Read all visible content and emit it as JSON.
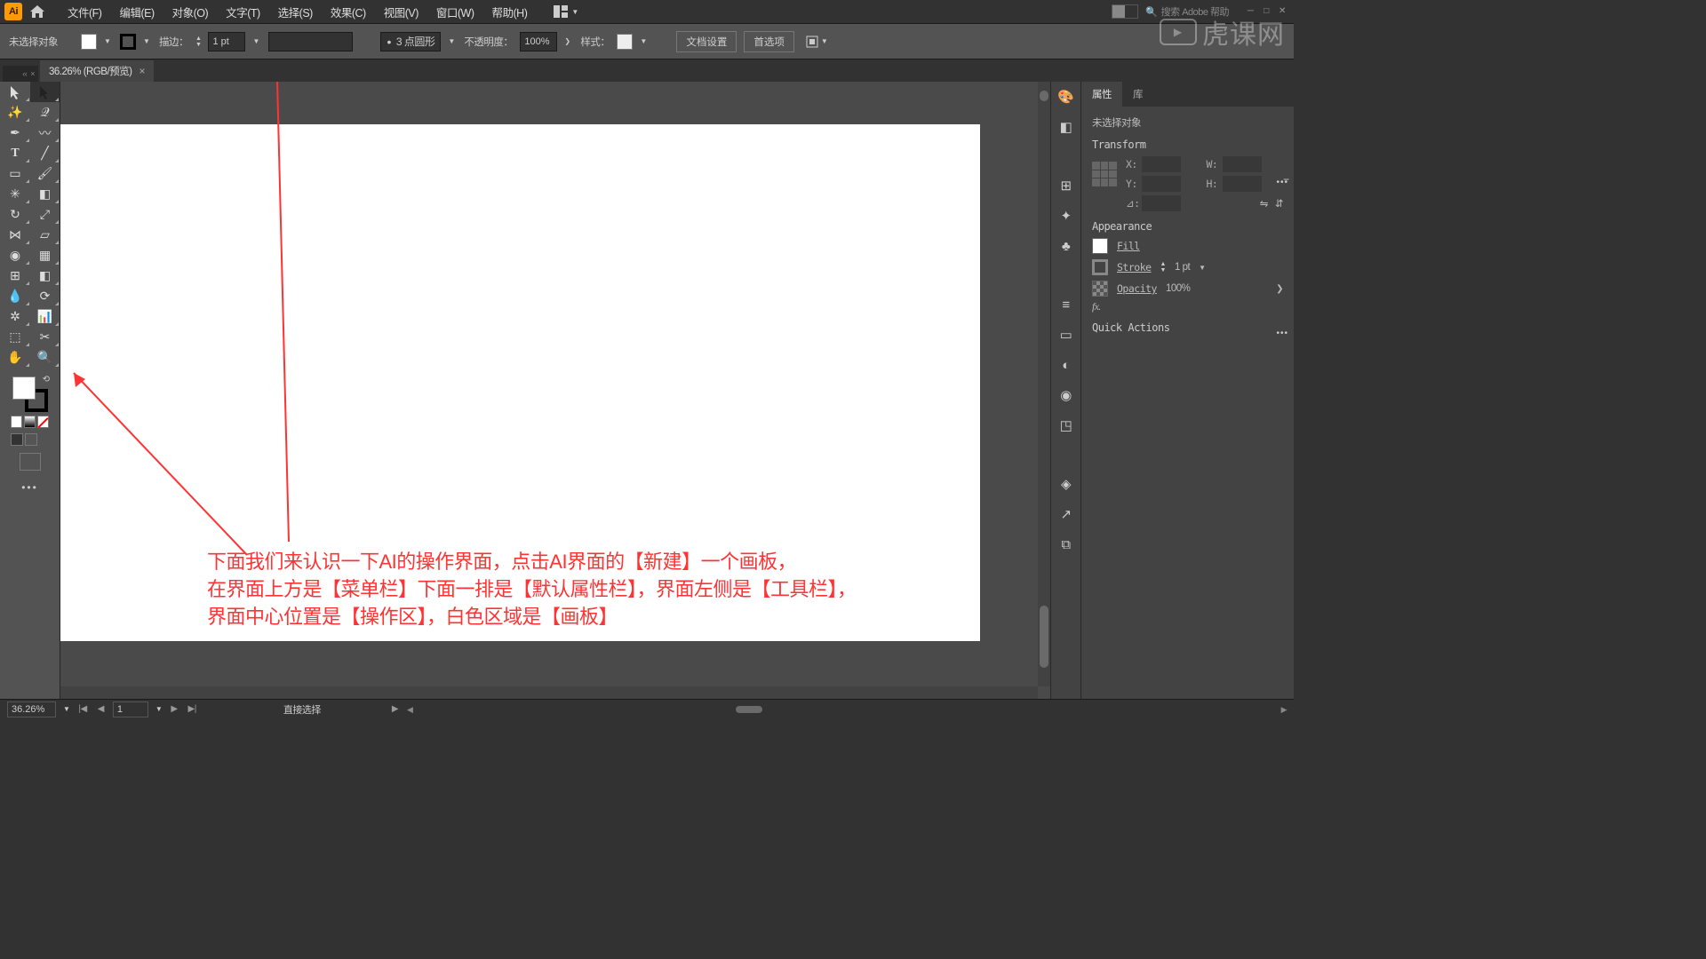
{
  "menubar": {
    "items": [
      "文件(F)",
      "编辑(E)",
      "对象(O)",
      "文字(T)",
      "选择(S)",
      "效果(C)",
      "视图(V)",
      "窗口(W)",
      "帮助(H)"
    ],
    "search_placeholder": "搜索 Adobe 帮助"
  },
  "controlbar": {
    "selection_label": "未选择对象",
    "stroke_label": "描边：",
    "stroke_value": "1 pt",
    "brush_label": "3 点圆形",
    "opacity_label": "不透明度：",
    "opacity_value": "100%",
    "style_label": "样式：",
    "doc_setup": "文档设置",
    "prefs": "首选项"
  },
  "tab": {
    "title": "36.26% (RGB/预览)"
  },
  "annotation": {
    "line1": "下面我们来认识一下AI的操作界面，点击AI界面的【新建】一个画板，",
    "line2": "在界面上方是【菜单栏】下面一排是【默认属性栏】，界面左侧是【工具栏】，",
    "line3": "界面中心位置是【操作区】，白色区域是【画板】"
  },
  "props": {
    "tabs": [
      "属性",
      "库"
    ],
    "no_selection": "未选择对象",
    "transform_title": "Transform",
    "fields": {
      "x": "X:",
      "y": "Y:",
      "w": "W:",
      "h": "H:",
      "angle": "⊿:"
    },
    "appearance_title": "Appearance",
    "fill_label": "Fill",
    "stroke_label": "Stroke",
    "stroke_value": "1 pt",
    "opacity_label": "Opacity",
    "opacity_value": "100%",
    "fx_label": "fx.",
    "quick_actions": "Quick Actions"
  },
  "statusbar": {
    "zoom": "36.26%",
    "artboard": "1",
    "tool_hint": "直接选择"
  },
  "watermark": "虎课网"
}
